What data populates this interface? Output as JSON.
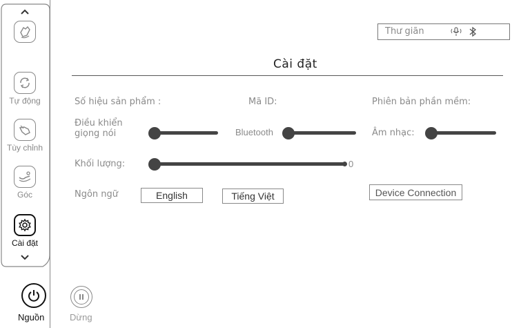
{
  "sidebar": {
    "items": [
      {
        "label": "",
        "icon": "hand-massage-icon"
      },
      {
        "label": "Tự động",
        "icon": "auto-cycle-icon"
      },
      {
        "label": "Tùy chỉnh",
        "icon": "custom-hand-icon"
      },
      {
        "label": "Góc",
        "icon": "recline-angle-icon"
      },
      {
        "label": "Cài đặt",
        "icon": "gear-icon"
      }
    ],
    "power_label": "Nguồn",
    "pause_label": "Dừng"
  },
  "header": {
    "mode_text": "Thư giãn",
    "voice_icon": "voice-icon",
    "bluetooth_icon": "bluetooth-icon"
  },
  "settings": {
    "title": "Cài đặt",
    "product_number_label": "Số hiệu sản phẩm :",
    "id_label": "Mã ID:",
    "software_version_label": "Phiên bản phần mềm:",
    "voice_control_label_line1": "Điều khiển",
    "voice_control_label_line2": "giọng nói",
    "bluetooth_label": "Bluetooth",
    "music_label": "Âm nhạc:",
    "volume_label": "Khối lượng:",
    "volume_value": "0",
    "language_label": "Ngôn ngữ",
    "lang_english": "English",
    "lang_vietnamese": "Tiếng Việt",
    "device_connection": "Device Connection"
  },
  "colors": {
    "track": "#444444",
    "text_muted": "#8a8a8a",
    "text_dark": "#222222",
    "border": "#888888"
  }
}
